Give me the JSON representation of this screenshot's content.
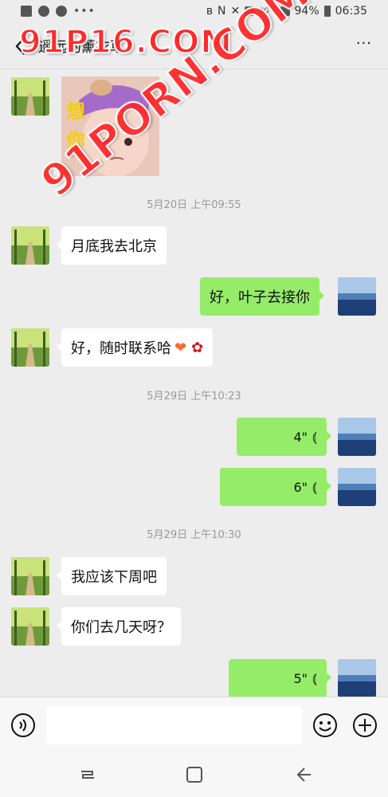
{
  "status_bar": {
    "network": "4G+",
    "battery": "94%",
    "time": "06:35"
  },
  "header": {
    "title": "遥远的薰衣草",
    "more": "···"
  },
  "watermark": {
    "top": "91P16.COM",
    "diagonal": "91PORN.COM"
  },
  "messages": {
    "sticker_text_1": "想",
    "sticker_text_2": "你",
    "time_1": "5月20日 上午09:55",
    "m1": "月底我去北京",
    "m2": "好，叶子去接你",
    "m3": "好，随时联系哈",
    "time_2": "5月29日 上午10:23",
    "v1": "4\"",
    "v2": "6\"",
    "time_3": "5月29日 上午10:30",
    "m4": "我应该下周吧",
    "m5": "你们去几天呀？",
    "v3": "5\""
  },
  "colors": {
    "background": "#ededed",
    "sent_bubble": "#95ec69",
    "received_bubble": "#ffffff",
    "watermark": "#ff2a2a"
  },
  "icons": [
    "back-icon",
    "more-icon",
    "voice-toggle-icon",
    "emoji-icon",
    "plus-icon",
    "recents-icon",
    "home-icon",
    "nav-back-icon"
  ]
}
